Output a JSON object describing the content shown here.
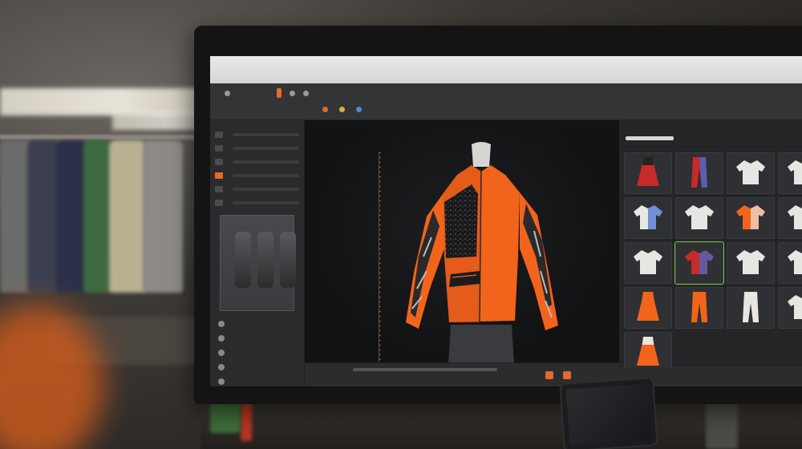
{
  "monitor": {
    "brand": "",
    "window_title": ""
  },
  "colors": {
    "accent": "#e8692a",
    "panel_bg": "#2d2e30",
    "viewport_bg": "#111214",
    "garment_orange": "#f2641c",
    "selection_green": "#7ac143"
  },
  "toolbar": {
    "row1": [
      "",
      "",
      "",
      "",
      "",
      "",
      ""
    ],
    "row2": [
      "",
      "",
      "",
      "",
      "",
      "",
      ""
    ]
  },
  "left_panel": {
    "rows": [
      "",
      "",
      "",
      "",
      "",
      ""
    ],
    "list": [
      "",
      "",
      "",
      "",
      ""
    ]
  },
  "right_panel": {
    "tabs": [
      "",
      ""
    ],
    "library_items": [
      {
        "icon": "dress-red-black-icon"
      },
      {
        "icon": "trousers-red-blue-icon"
      },
      {
        "icon": "blouse-white-icon"
      },
      {
        "icon": "top-white-icon"
      },
      {
        "icon": "shirt-white-blue-icon"
      },
      {
        "icon": "shirt-white-icon"
      },
      {
        "icon": "jacket-orange-white-icon"
      },
      {
        "icon": "top-white-icon"
      },
      {
        "icon": "shirt-white-icon"
      },
      {
        "icon": "swimsuit-red-blue-icon"
      },
      {
        "icon": "sweater-white-icon"
      },
      {
        "icon": "top-white-icon"
      },
      {
        "icon": "dress-orange-icon"
      },
      {
        "icon": "jumpsuit-orange-icon"
      },
      {
        "icon": "pantsuit-white-icon"
      },
      {
        "icon": "top-white-icon"
      },
      {
        "icon": "skirt-white-orange-icon"
      }
    ]
  }
}
